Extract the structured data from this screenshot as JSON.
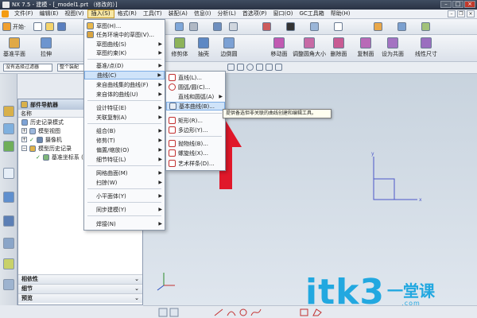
{
  "window": {
    "title": "NX 7.5 - 建模 - [_model1.prt （修改的）]"
  },
  "menubar": {
    "items": [
      "文件(F)",
      "编辑(E)",
      "视图(V)",
      "插入(S)",
      "格式(R)",
      "工具(T)",
      "装配(A)",
      "信息(I)",
      "分析(L)",
      "首选项(P)",
      "窗口(O)",
      "GC工具箱",
      "帮助(H)"
    ],
    "active_index": 3
  },
  "toolbar1": {
    "start_label": "开始·"
  },
  "toolbar2": {
    "datum_plane": "基准平面",
    "extrude": "拉伸",
    "trim_body": "修剪体",
    "extract": "抽壳",
    "edge_blend": "边倒圆",
    "move_face": "移动面",
    "resize": "调整圆角大小",
    "delete_face": "删除面",
    "copy_face": "复制面",
    "offset_face": "设为共面",
    "linear_dim": "线性尺寸"
  },
  "toolbar3": {
    "filter_label": "没有选择过滤器",
    "assembly_label": "整个装配"
  },
  "nav": {
    "title": "部件导航器",
    "column": "名称",
    "tree": [
      "历史记录模式",
      "模型视图",
      "摄像机",
      "模型历史记录",
      "基准坐标系 (0)"
    ],
    "sections": [
      "相依性",
      "细节",
      "预览"
    ]
  },
  "insert_menu": {
    "items": [
      "草图(H)...",
      "任务环境中的草图(V)...",
      "草图曲线(S)",
      "草图约束(K)",
      "基准/点(D)",
      "曲线(C)",
      "来自曲线集的曲线(F)",
      "来自体的曲线(U)",
      "设计特征(E)",
      "关联复制(A)",
      "组合(B)",
      "修剪(T)",
      "偏置/缩放(O)",
      "细节特征(L)",
      "网格曲面(M)",
      "扫掠(W)",
      "小平面体(Y)",
      "同步建模(Y)",
      "焊接(N)"
    ]
  },
  "curve_menu": {
    "items": [
      "直线(L)...",
      "圆弧/圆(C)...",
      "直线和圆弧(A)",
      "基本曲线(B)...",
      "矩形(R)...",
      "多边形(Y)...",
      "抛物线(B)...",
      "螺旋线(X)...",
      "艺术样条(D)..."
    ]
  },
  "tooltip": "提供备选但非关联的曲线创建和编辑工具。",
  "watermark": {
    "main": "itk3",
    "cn": "一堂课",
    "url": ".com"
  }
}
